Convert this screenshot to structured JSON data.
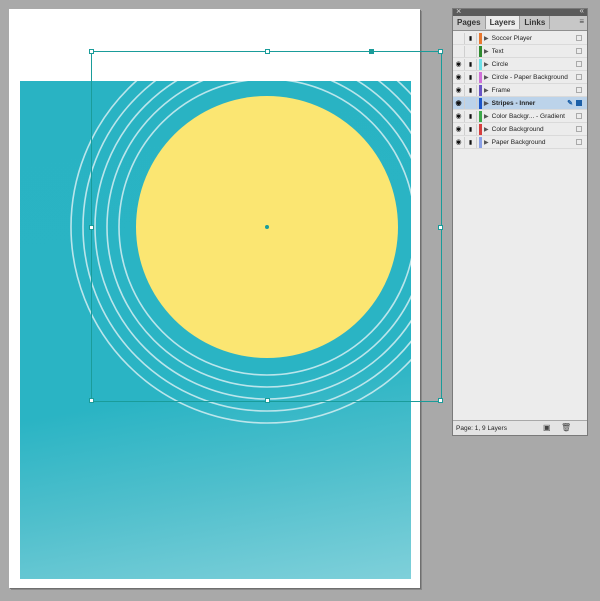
{
  "panel": {
    "close_glyph": "×",
    "collapse_glyph": "«",
    "tabs": [
      {
        "label": "Pages"
      },
      {
        "label": "Layers"
      },
      {
        "label": "Links"
      }
    ],
    "menu_glyph": "≡",
    "layers": [
      {
        "name": "Soccer Player",
        "color": "#e8772e",
        "visible": false,
        "locked": true
      },
      {
        "name": "Text",
        "color": "#2f8a2f",
        "visible": false,
        "locked": false
      },
      {
        "name": "Circle",
        "color": "#6de0e8",
        "visible": true,
        "locked": true
      },
      {
        "name": "Circle - Paper Background",
        "color": "#d070d8",
        "visible": true,
        "locked": true
      },
      {
        "name": "Frame",
        "color": "#6a54c4",
        "visible": true,
        "locked": true
      },
      {
        "name": "Stripes - Inner",
        "color": "#1b55c9",
        "visible": true,
        "locked": false,
        "selected": true
      },
      {
        "name": "Color Backgr... - Gradient",
        "color": "#3ca84a",
        "visible": true,
        "locked": true
      },
      {
        "name": "Color Background",
        "color": "#d63e3e",
        "visible": true,
        "locked": true
      },
      {
        "name": "Paper Background",
        "color": "#8aa0e6",
        "visible": true,
        "locked": true
      }
    ],
    "status": "Page: 1, 9 Layers",
    "eye_glyph": "◉",
    "lock_glyph": "🔒",
    "pen_glyph": "✎",
    "new_glyph": "▣",
    "trash_glyph": "🗑"
  },
  "canvas": {
    "background_color": "#2ab4c4",
    "circle_color": "#fbe672",
    "ring_color": "#d4eef2",
    "ring_count": 5
  }
}
